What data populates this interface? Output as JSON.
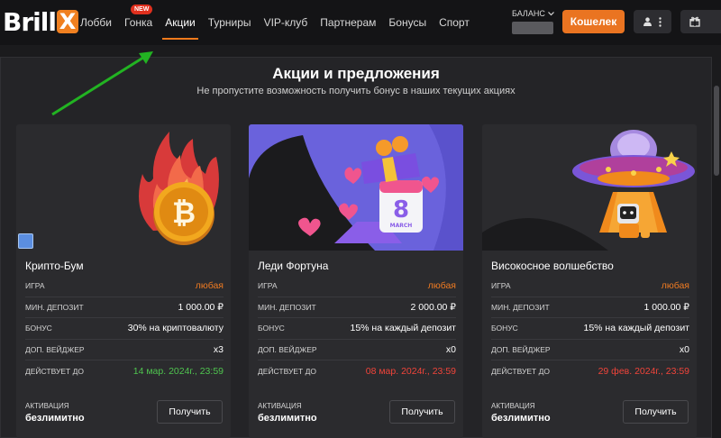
{
  "brand": {
    "logo_text": "Brill",
    "logo_mark": "X"
  },
  "nav": {
    "items": [
      {
        "label": "Лобби"
      },
      {
        "label": "Гонка",
        "badge": "NEW"
      },
      {
        "label": "Акции",
        "active": true
      },
      {
        "label": "Турниры"
      },
      {
        "label": "VIP-клуб"
      },
      {
        "label": "Партнерам"
      },
      {
        "label": "Бонусы"
      },
      {
        "label": "Спорт"
      }
    ]
  },
  "header": {
    "balance_label": "БАЛАНС",
    "wallet_label": "Кошелек",
    "user_icon": "user-icon",
    "menu_icon": "more-vertical-icon",
    "gift_icon": "gift-icon"
  },
  "page": {
    "title": "Акции и предложения",
    "subtitle": "Не пропустите возможность получить бонус в наших текущих акциях"
  },
  "labels": {
    "game": "ИГРА",
    "min_deposit": "МИН. ДЕПОЗИТ",
    "bonus": "БОНУС",
    "wager": "ДОП. ВЕЙДЖЕР",
    "valid_until": "ДЕЙСТВУЕТ ДО",
    "activation": "АКТИВАЦИЯ",
    "get": "Получить"
  },
  "cards": [
    {
      "title": "Крипто-Бум",
      "game": "любая",
      "min_deposit": "1 000.00 ₽",
      "bonus": "30% на криптовалюту",
      "wager": "x3",
      "valid_until": "14 мар. 2024г., 23:59",
      "valid_status": "green",
      "activation": "безлимитно",
      "image_icon": "bitcoin-fire-icon"
    },
    {
      "title": "Леди Фортуна",
      "game": "любая",
      "min_deposit": "2 000.00 ₽",
      "bonus": "15% на каждый депозит",
      "wager": "x0",
      "valid_until": "08 мар. 2024г., 23:59",
      "valid_status": "red",
      "activation": "безлимитно",
      "image_icon": "march-8-gift-icon",
      "image_text": "MARCH"
    },
    {
      "title": "Високосное волшебство",
      "game": "любая",
      "min_deposit": "1 000.00 ₽",
      "bonus": "15% на каждый депозит",
      "wager": "x0",
      "valid_until": "29 фев. 2024г., 23:59",
      "valid_status": "red",
      "activation": "безлимитно",
      "image_icon": "ufo-robot-icon"
    }
  ],
  "colors": {
    "accent": "#ea7421",
    "green": "#4fc44f",
    "red": "#f0443a",
    "arrow": "#22b322"
  }
}
